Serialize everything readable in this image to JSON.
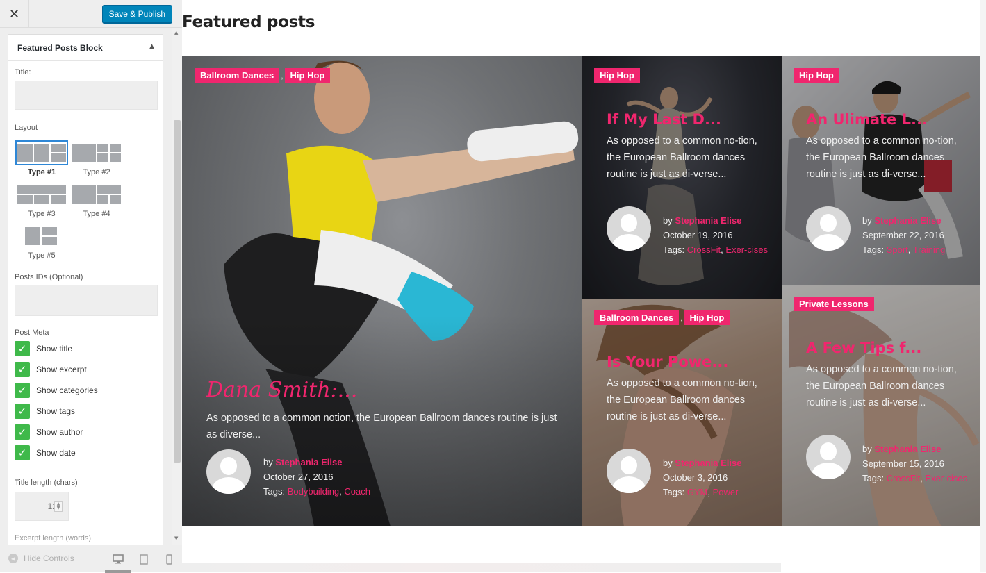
{
  "customizer": {
    "close_icon": "close-icon",
    "publish_label": "Save & Publish",
    "accent": "#0085ba",
    "section_title": "Featured Posts Block",
    "title_label": "Title:",
    "title_value": "",
    "layout_label": "Layout",
    "layouts": [
      {
        "label": "Type #1",
        "selected": true
      },
      {
        "label": "Type #2",
        "selected": false
      },
      {
        "label": "Type #3",
        "selected": false
      },
      {
        "label": "Type #4",
        "selected": false
      },
      {
        "label": "Type #5",
        "selected": false
      }
    ],
    "posts_ids_label": "Posts IDs (Optional)",
    "posts_ids_value": "",
    "post_meta_label": "Post Meta",
    "post_meta": [
      {
        "label": "Show title",
        "checked": true
      },
      {
        "label": "Show excerpt",
        "checked": true
      },
      {
        "label": "Show categories",
        "checked": true
      },
      {
        "label": "Show tags",
        "checked": true
      },
      {
        "label": "Show author",
        "checked": true
      },
      {
        "label": "Show date",
        "checked": true
      }
    ],
    "title_length_label": "Title length (chars)",
    "title_length_value": "12",
    "excerpt_length_label": "Excerpt length (words)",
    "hide_controls_label": "Hide Controls",
    "devices": [
      "desktop-icon",
      "tablet-icon",
      "mobile-icon"
    ],
    "checkbox_color": "#3fb94a"
  },
  "preview": {
    "block_title": "Featured posts",
    "accent": "#f0266e",
    "posts": [
      {
        "categories": [
          "Ballroom Dances",
          "Hip Hop"
        ],
        "title": "Dana Smith:...",
        "excerpt": "As opposed to a common notion, the European Ballroom dances routine is just as diverse...",
        "by": "by",
        "author": "Stephania Elise",
        "date": "October 27, 2016",
        "tags_label": "Tags:",
        "tags": [
          "Bodybuilding",
          "Coach"
        ]
      },
      {
        "categories": [
          "Hip Hop"
        ],
        "title": "If My Last D...",
        "excerpt": "As opposed to a common no-tion, the European Ballroom dances routine is just as di-verse...",
        "by": "by",
        "author": "Stephania Elise",
        "date": "October 19, 2016",
        "tags_label": "Tags:",
        "tags": [
          "CrossFit",
          "Exer-cises"
        ]
      },
      {
        "categories": [
          "Hip Hop"
        ],
        "title": "An Ulimate L...",
        "excerpt": "As opposed to a common no-tion, the European Ballroom dances routine is just as di-verse...",
        "by": "by",
        "author": "Stephania Elise",
        "date": "September 22, 2016",
        "tags_label": "Tags:",
        "tags": [
          "Sport",
          "Training"
        ]
      },
      {
        "categories": [
          "Ballroom Dances",
          "Hip Hop"
        ],
        "title": "Is Your Powe...",
        "excerpt": "As opposed to a common no-tion, the European Ballroom dances routine is just as di-verse...",
        "by": "by",
        "author": "Stephania Elise",
        "date": "October 3, 2016",
        "tags_label": "Tags:",
        "tags": [
          "GYM",
          "Power"
        ]
      },
      {
        "categories": [
          "Private Lessons"
        ],
        "title": "A Few Tips f...",
        "excerpt": "As opposed to a common no-tion, the European Ballroom dances routine is just as di-verse...",
        "by": "by",
        "author": "Stephania Elise",
        "date": "September 15, 2016",
        "tags_label": "Tags:",
        "tags": [
          "CrossFit",
          "Exer-cises"
        ]
      }
    ]
  }
}
